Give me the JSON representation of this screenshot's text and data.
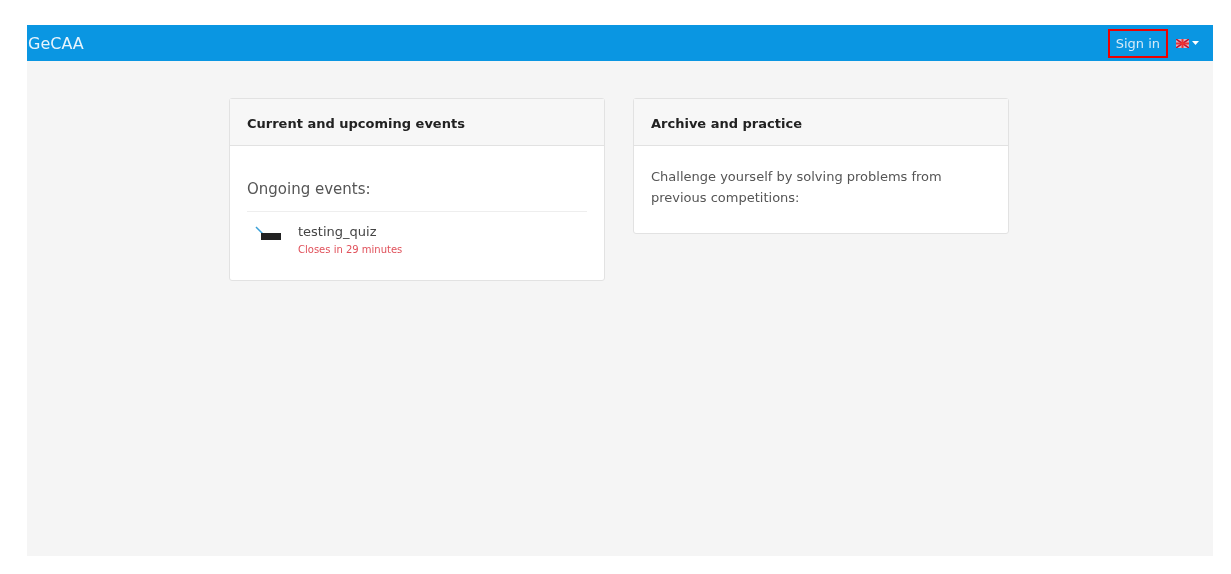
{
  "navbar": {
    "brand": "GeCAA",
    "sign_in": {
      "label": "Sign in",
      "highlighted": true
    },
    "language_menu": {
      "expanded": false
    }
  },
  "cards": [
    {
      "title": "Current and upcoming events",
      "section_heading": "Ongoing events:",
      "events": [
        {
          "name": "testing_quiz",
          "status": "Closes in 29 minutes"
        }
      ]
    },
    {
      "title": "Archive and practice",
      "text": "Challenge yourself by solving problems from previous competitions:"
    }
  ]
}
